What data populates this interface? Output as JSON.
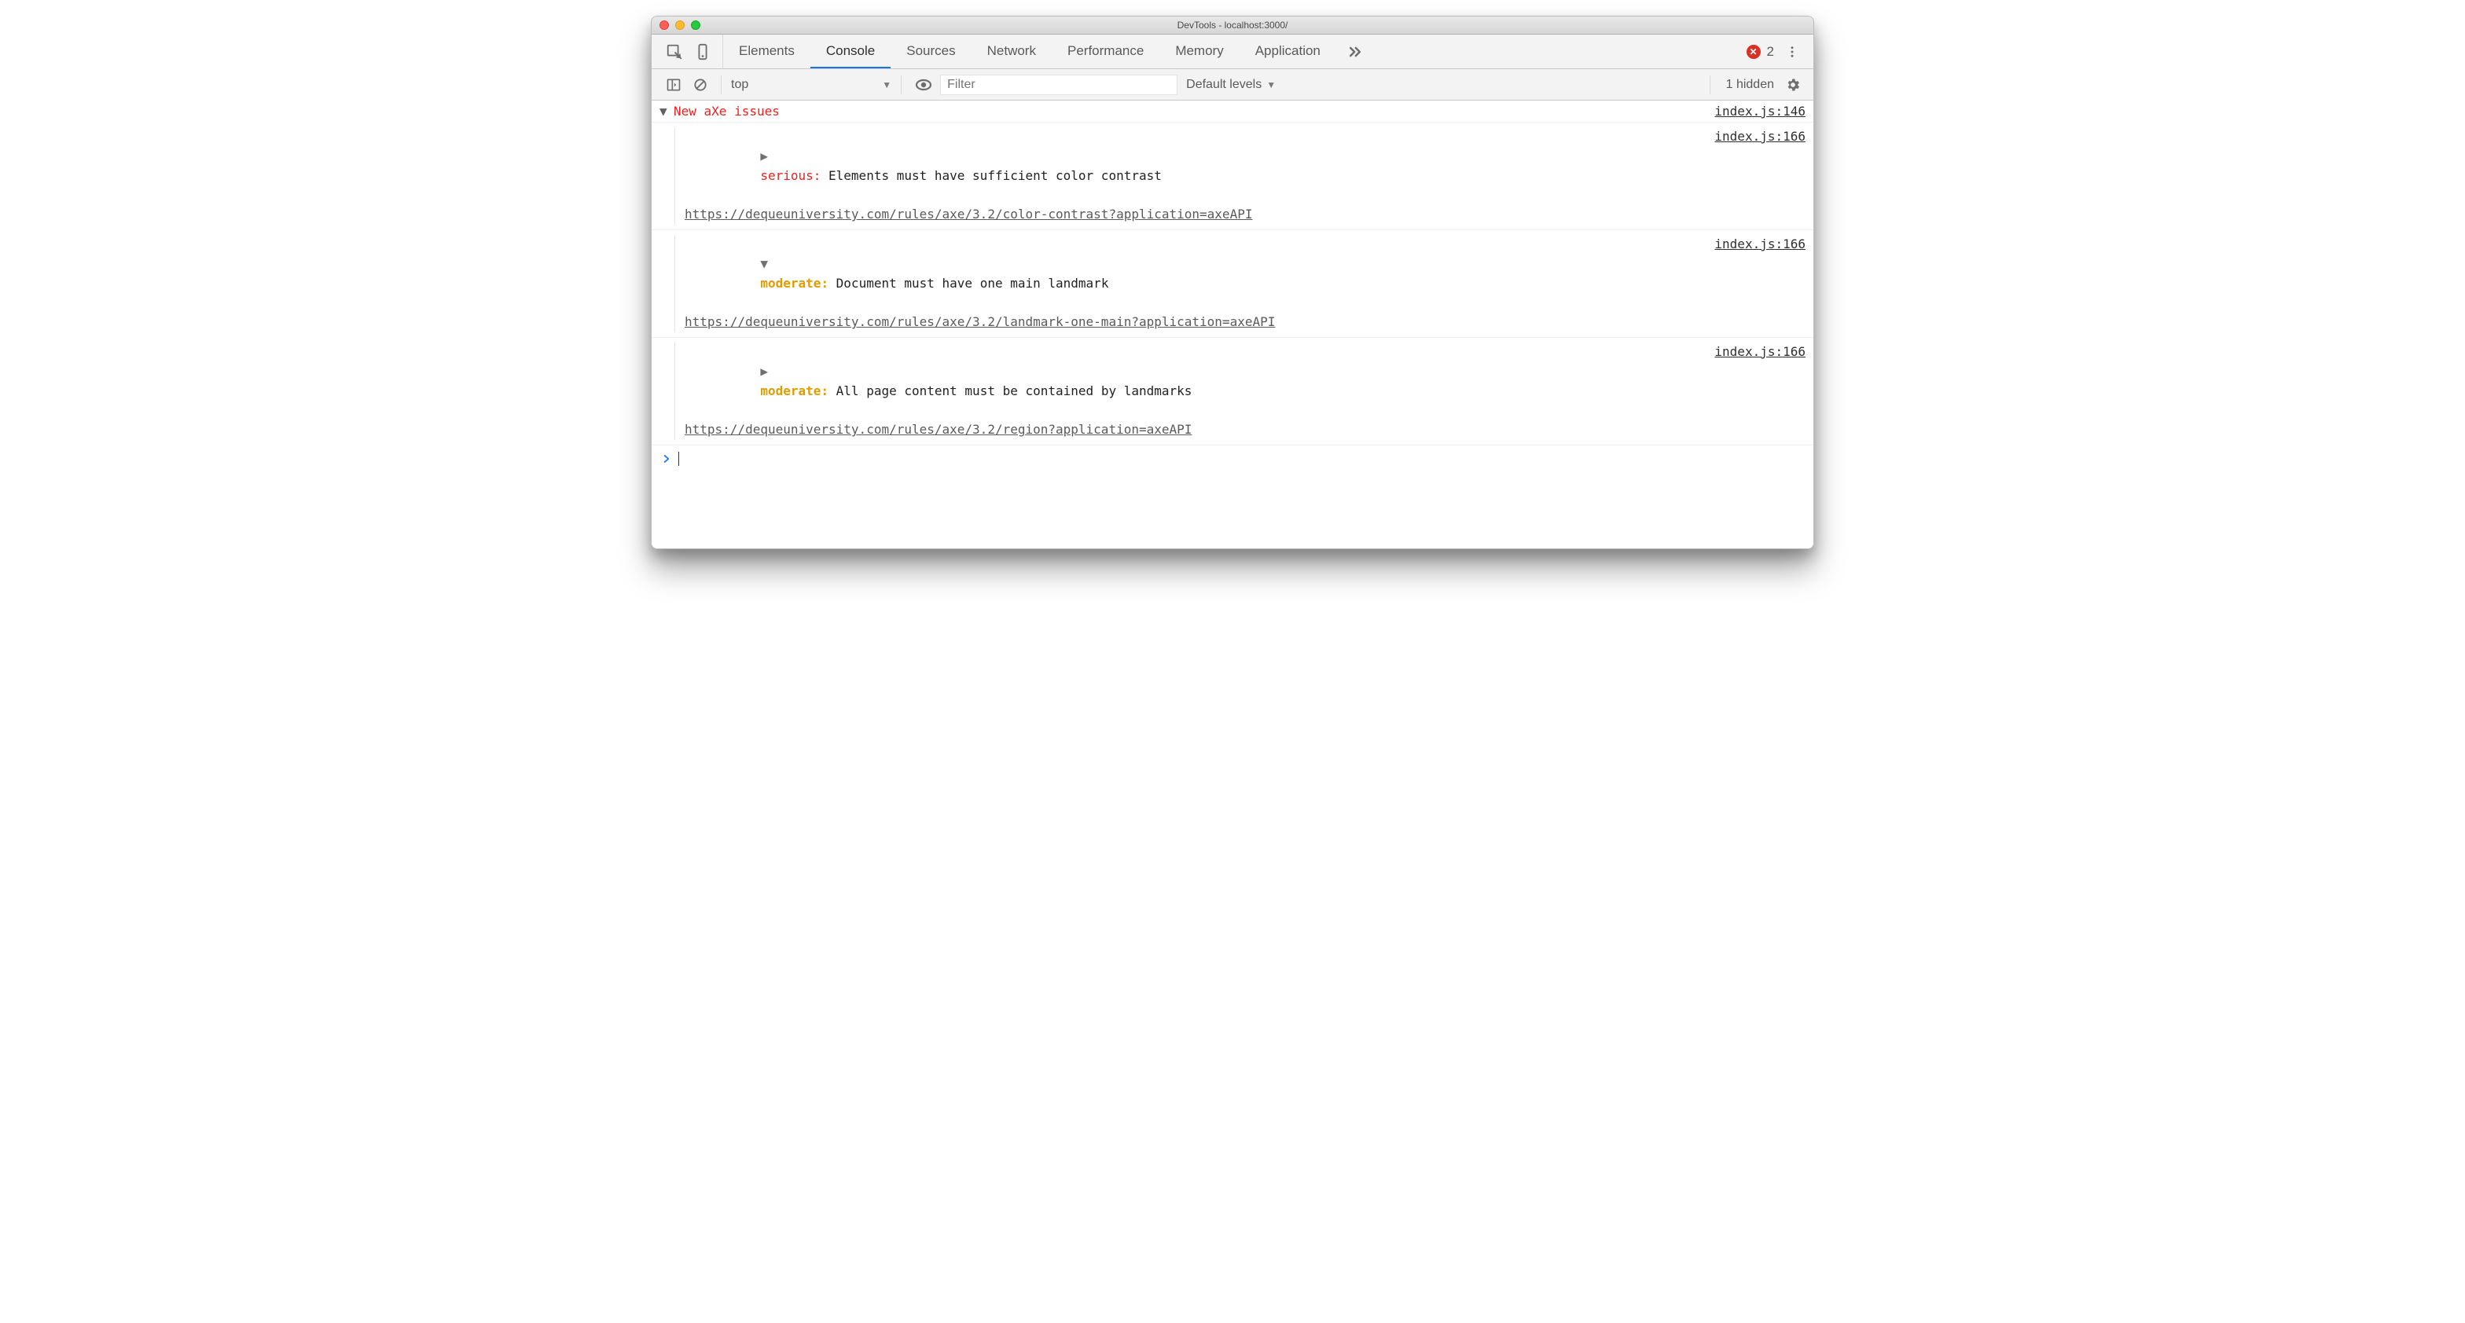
{
  "window": {
    "title": "DevTools - localhost:3000/"
  },
  "tabs": {
    "t0": "Elements",
    "t1": "Console",
    "t2": "Sources",
    "t3": "Network",
    "t4": "Performance",
    "t5": "Memory",
    "t6": "Application",
    "error_count": "2"
  },
  "console_toolbar": {
    "context": "top",
    "filter_placeholder": "Filter",
    "levels": "Default levels",
    "hidden": "1 hidden"
  },
  "group": {
    "title": "New aXe issues",
    "src": "index.js:146"
  },
  "issues": {
    "i0": {
      "disclosure": "▶",
      "sev_label": "serious:",
      "sev_class": "sev-serious",
      "msg": " Elements must have sufficient color contrast",
      "url": "https://dequeuniversity.com/rules/axe/3.2/color-contrast?application=axeAPI",
      "src": "index.js:166"
    },
    "i1": {
      "disclosure": "▼",
      "sev_label": "moderate:",
      "sev_class": "sev-moderate",
      "msg": " Document must have one main landmark",
      "url": "https://dequeuniversity.com/rules/axe/3.2/landmark-one-main?application=axeAPI",
      "src": "index.js:166"
    },
    "i2": {
      "disclosure": "▶",
      "sev_label": "moderate:",
      "sev_class": "sev-moderate",
      "msg": " All page content must be contained by landmarks",
      "url": "https://dequeuniversity.com/rules/axe/3.2/region?application=axeAPI",
      "src": "index.js:166"
    }
  }
}
